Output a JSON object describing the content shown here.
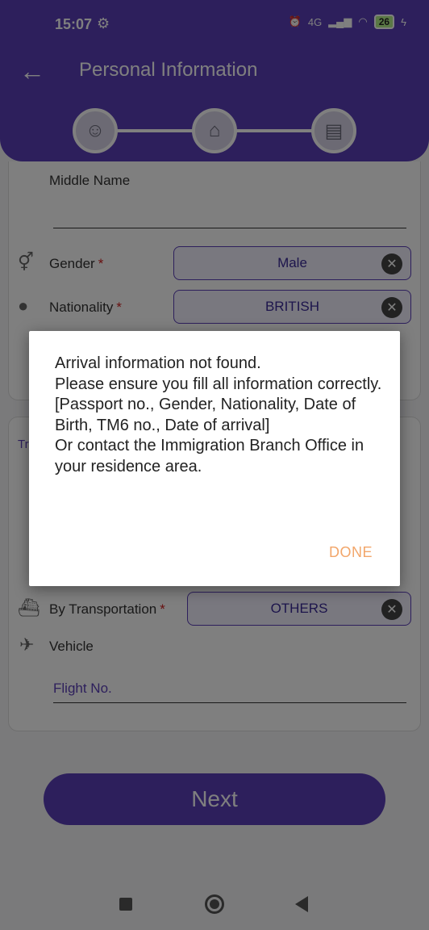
{
  "status_bar": {
    "time": "15:07",
    "battery": "26",
    "network": "4G"
  },
  "header": {
    "title": "Personal Information"
  },
  "stepper": {
    "steps": [
      "person-icon",
      "house-icon",
      "clipboard-icon"
    ]
  },
  "form": {
    "middle_name_label": "Middle Name",
    "gender_label": "Gender",
    "gender_value": "Male",
    "nationality_label": "Nationality",
    "nationality_value": "BRITISH",
    "section2_title_partial": "Tr",
    "transport_label": "By Transportation",
    "transport_value": "OTHERS",
    "vehicle_label": "Vehicle",
    "flight_placeholder": "Flight No.",
    "required_mark": "*"
  },
  "next_button": {
    "label": "Next"
  },
  "dialog": {
    "message": "Arrival information not found.\nPlease ensure you fill all information correctly.\n[Passport no., Gender, Nationality, Date of Birth, TM6 no., Date of arrival]\nOr contact the Immigration Branch Office in your residence area.",
    "done_label": "DONE"
  },
  "colors": {
    "primary": "#5b3fb8",
    "accent_done": "#f2a66a",
    "required": "#d02020"
  }
}
